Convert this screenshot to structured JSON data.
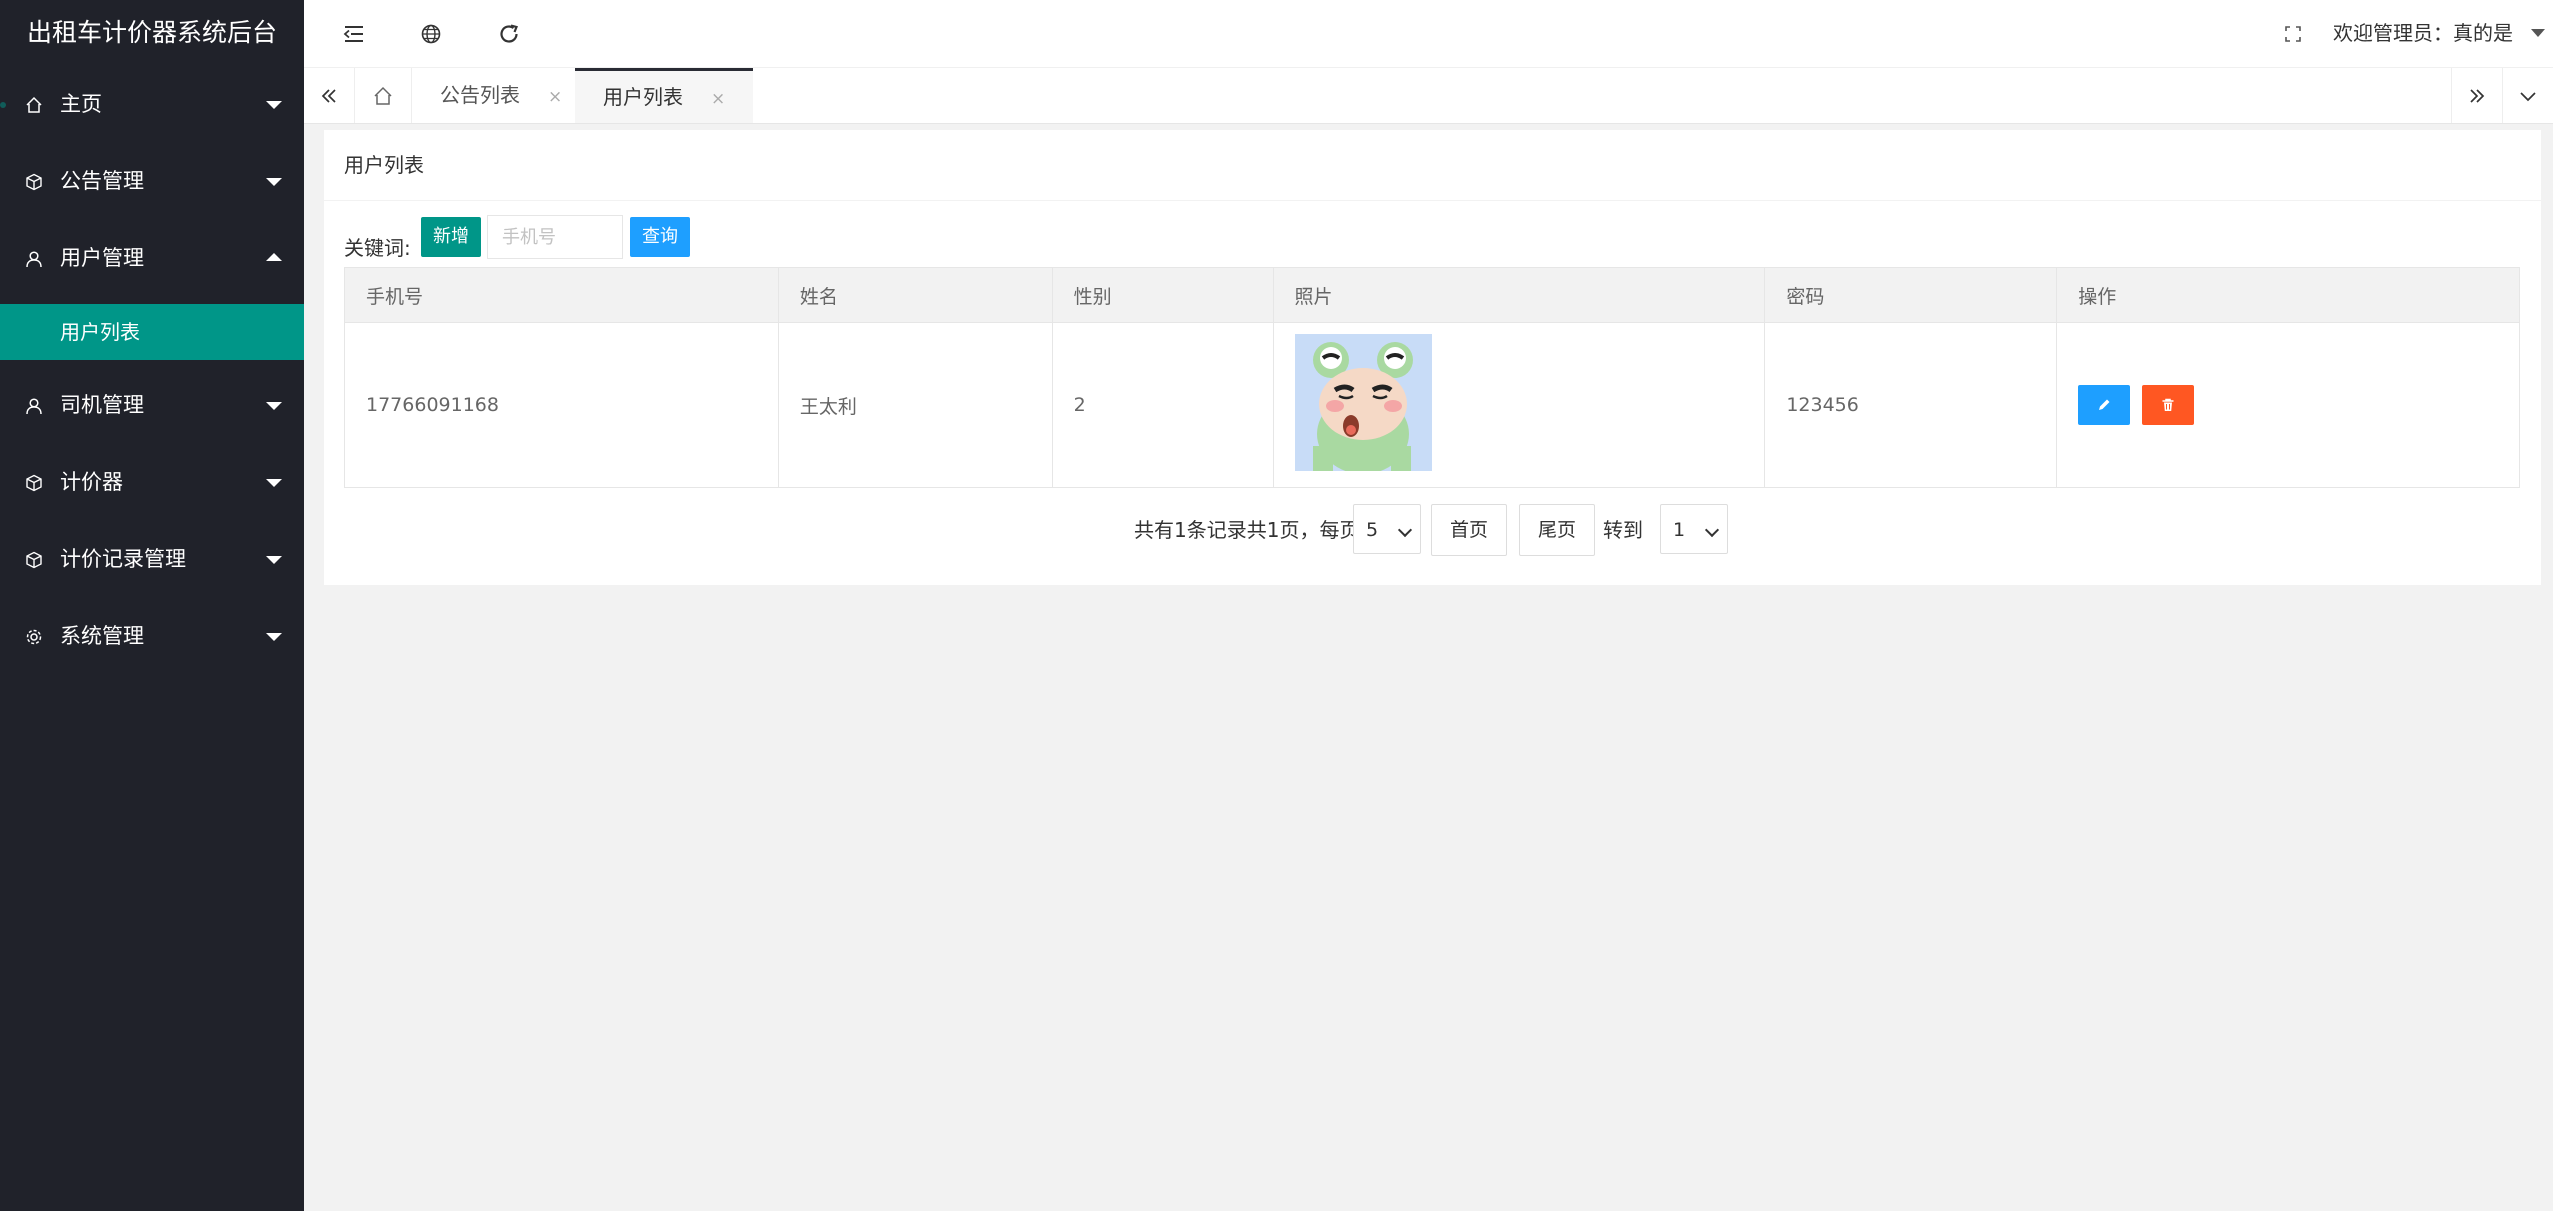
{
  "app": {
    "title": "出租车计价器系统后台"
  },
  "sidebar": {
    "items": [
      {
        "label": "主页",
        "icon": "home-icon"
      },
      {
        "label": "公告管理",
        "icon": "cube-icon"
      },
      {
        "label": "用户管理",
        "icon": "user-icon",
        "expanded": true,
        "children": [
          {
            "label": "用户列表",
            "active": true
          }
        ]
      },
      {
        "label": "司机管理",
        "icon": "user-icon"
      },
      {
        "label": "计价器",
        "icon": "cube-icon"
      },
      {
        "label": "计价记录管理",
        "icon": "cube-icon"
      },
      {
        "label": "系统管理",
        "icon": "gear-icon"
      }
    ]
  },
  "header": {
    "welcome": "欢迎管理员：真的是",
    "icons": [
      "menu-collapse-icon",
      "globe-icon",
      "refresh-icon",
      "fullscreen-icon"
    ]
  },
  "tabs": {
    "items": [
      {
        "label": "公告列表",
        "active": false
      },
      {
        "label": "用户列表",
        "active": true
      }
    ],
    "close_glyph": "×"
  },
  "page": {
    "title": "用户列表",
    "keyword_label": "关键词:",
    "add_label": "新增",
    "search_placeholder": "手机号",
    "query_label": "查询"
  },
  "table": {
    "headers": [
      "手机号",
      "姓名",
      "性别",
      "照片",
      "密码",
      "操作"
    ],
    "rows": [
      {
        "phone": "17766091168",
        "name": "王太利",
        "gender": "2",
        "photo": "frog-avatar",
        "password": "123456"
      }
    ]
  },
  "pagination": {
    "summary": "共有1条记录共1页，每页",
    "page_size": "5",
    "first_label": "首页",
    "last_label": "尾页",
    "goto_label": "转到",
    "goto_page": "1"
  },
  "colors": {
    "sidebar_bg": "#20222a",
    "accent": "#009688",
    "primary": "#1e9fff",
    "danger": "#ff5722"
  }
}
